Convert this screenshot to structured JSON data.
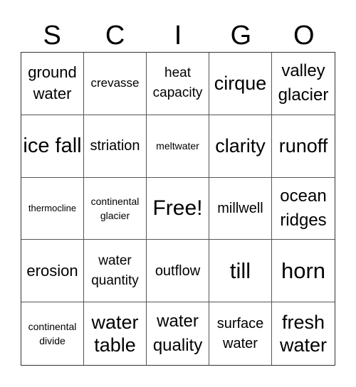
{
  "header": {
    "letters": [
      "S",
      "C",
      "I",
      "G",
      "O"
    ]
  },
  "board": {
    "cells": [
      {
        "text": "ground water"
      },
      {
        "text": "crevasse"
      },
      {
        "text": "heat capacity"
      },
      {
        "text": "cirque"
      },
      {
        "text": "valley glacier"
      },
      {
        "text": "ice fall"
      },
      {
        "text": "striation"
      },
      {
        "text": "meltwater"
      },
      {
        "text": "clarity"
      },
      {
        "text": "runoff"
      },
      {
        "text": "thermocline"
      },
      {
        "text": "continental glacier"
      },
      {
        "text": "Free!"
      },
      {
        "text": "millwell"
      },
      {
        "text": "ocean ridges"
      },
      {
        "text": "erosion"
      },
      {
        "text": "water quantity"
      },
      {
        "text": "outflow"
      },
      {
        "text": "till"
      },
      {
        "text": "horn"
      },
      {
        "text": "continental divide"
      },
      {
        "text": "water table"
      },
      {
        "text": "water quality"
      },
      {
        "text": "surface water"
      },
      {
        "text": "fresh water"
      }
    ]
  }
}
